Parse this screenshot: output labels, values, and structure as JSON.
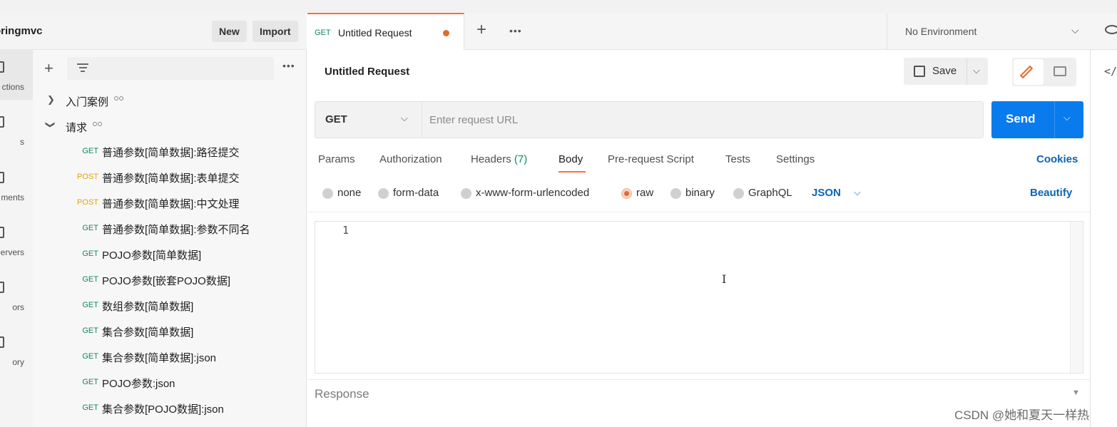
{
  "workspace": {
    "name": "pringmvc",
    "new_label": "New",
    "import_label": "Import"
  },
  "rail": {
    "items": [
      {
        "label": "ctions",
        "icon": "collections-icon"
      },
      {
        "label": "s",
        "icon": "apis-icon"
      },
      {
        "label": "ments",
        "icon": "environments-icon"
      },
      {
        "label": "ervers",
        "icon": "mock-servers-icon"
      },
      {
        "label": "ors",
        "icon": "monitors-icon"
      },
      {
        "label": "ory",
        "icon": "history-icon"
      }
    ]
  },
  "sidebar": {
    "folders": [
      {
        "name": "入门案例",
        "expanded": false
      },
      {
        "name": "请求",
        "expanded": true
      }
    ],
    "requests": [
      {
        "method": "GET",
        "name": "普通参数[简单数据]:路径提交"
      },
      {
        "method": "POST",
        "name": "普通参数[简单数据]:表单提交"
      },
      {
        "method": "POST",
        "name": "普通参数[简单数据]:中文处理"
      },
      {
        "method": "GET",
        "name": "普通参数[简单数据]:参数不同名"
      },
      {
        "method": "GET",
        "name": "POJO参数[简单数据]"
      },
      {
        "method": "GET",
        "name": "POJO参数[嵌套POJO数据]"
      },
      {
        "method": "GET",
        "name": "数组参数[简单数据]"
      },
      {
        "method": "GET",
        "name": "集合参数[简单数据]"
      },
      {
        "method": "GET",
        "name": "集合参数[简单数据]:json"
      },
      {
        "method": "GET",
        "name": "POJO参数:json"
      },
      {
        "method": "GET",
        "name": "集合参数[POJO数据]:json"
      }
    ]
  },
  "tabs": {
    "active": {
      "method": "GET",
      "title": "Untitled Request"
    },
    "environment": "No Environment"
  },
  "request": {
    "title": "Untitled Request",
    "save_label": "Save",
    "method": "GET",
    "url_placeholder": "Enter request URL",
    "url_value": "",
    "send_label": "Send",
    "tabs": [
      {
        "label": "Params"
      },
      {
        "label": "Authorization"
      },
      {
        "label": "Headers",
        "count": "(7)"
      },
      {
        "label": "Body",
        "active": true
      },
      {
        "label": "Pre-request Script"
      },
      {
        "label": "Tests"
      },
      {
        "label": "Settings"
      }
    ],
    "cookies_label": "Cookies",
    "body_types": [
      {
        "label": "none",
        "selected": false
      },
      {
        "label": "form-data",
        "selected": false
      },
      {
        "label": "x-www-form-urlencoded",
        "selected": false
      },
      {
        "label": "raw",
        "selected": true
      },
      {
        "label": "binary",
        "selected": false
      },
      {
        "label": "GraphQL",
        "selected": false
      }
    ],
    "raw_format": "JSON",
    "beautify_label": "Beautify",
    "editor_line": "1"
  },
  "response": {
    "label": "Response"
  },
  "watermark": "CSDN @她和夏天一样热",
  "colors": {
    "accent": "#ff6c37",
    "send": "#097bed",
    "get": "#0f8a5b",
    "post": "#e0a30f",
    "link": "#0b63b6"
  }
}
